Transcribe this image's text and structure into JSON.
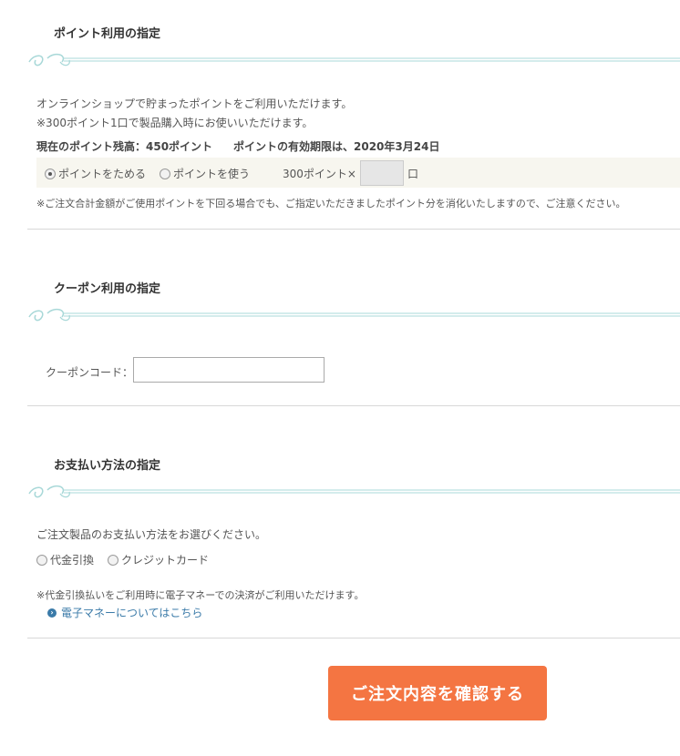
{
  "points": {
    "title": "ポイント利用の指定",
    "desc1": "オンラインショップで貯まったポイントをご利用いただけます。",
    "desc2": "※300ポイント1口で製品購入時にお使いいただけます。",
    "balance": "現在のポイント残高：450ポイント",
    "expiry": "ポイントの有効期限は、2020年3月24日",
    "option_save": "ポイントをためる",
    "option_use": "ポイントを使う",
    "multiplier": "300ポイント×",
    "unit": "口",
    "note": "※ご注文合計金額がご使用ポイントを下回る場合でも、ご指定いただきましたポイント分を消化いたしますので、ご注意ください。"
  },
  "coupon": {
    "title": "クーポン利用の指定",
    "label": "クーポンコード："
  },
  "payment": {
    "title": "お支払い方法の指定",
    "prompt": "ご注文製品のお支払い方法をお選びください。",
    "option_cod": "代金引換",
    "option_card": "クレジットカード",
    "note": "※代金引換払いをご利用時に電子マネーでの決済がご利用いただけます。",
    "link": "電子マネーについてはこちら"
  },
  "confirm_label": "ご注文内容を確認する",
  "colors": {
    "accent": "#f47542",
    "ornament": "#a8d8d8",
    "link": "#3a7aa8"
  }
}
